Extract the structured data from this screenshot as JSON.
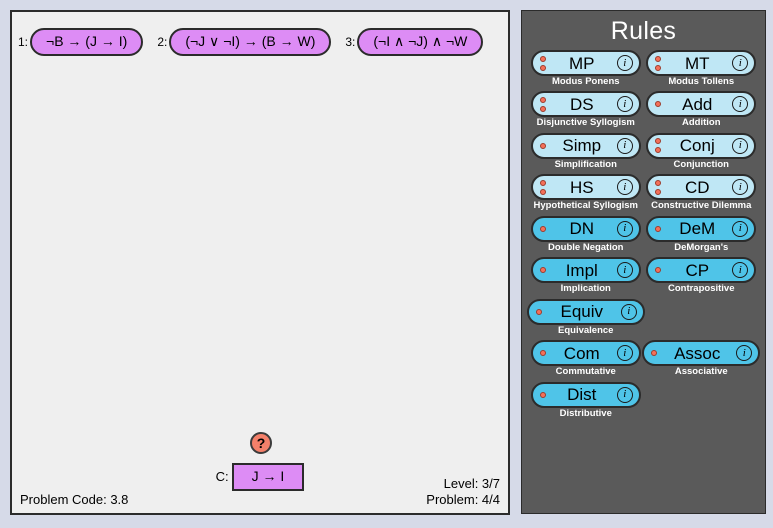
{
  "premises": [
    {
      "index": "1:",
      "formula": "¬B → (J → I)"
    },
    {
      "index": "2:",
      "formula": "(¬J ∨ ¬I) → (B → W)"
    },
    {
      "index": "3:",
      "formula": "(¬I ∧ ¬J) ∧ ¬W"
    }
  ],
  "conclusion": {
    "label": "C:",
    "formula": "J → I",
    "status_badge": "?"
  },
  "footer": {
    "problem_code": "Problem Code: 3.8",
    "level": "Level: 3/7",
    "problem": "Problem: 4/4"
  },
  "rules_panel": {
    "title": "Rules",
    "info_glyph": "i",
    "colors": {
      "panel_bg": "#5a5a5a",
      "button_light": "#bfe7f5",
      "button_dark": "#4fc4e8",
      "dot": "#f4705a",
      "premise_pill": "#dd8cf5",
      "badge": "#f4806a"
    },
    "rules": [
      {
        "abbr": "MP",
        "name": "Modus Ponens",
        "dots": 2,
        "shade": "light",
        "wide": false
      },
      {
        "abbr": "MT",
        "name": "Modus Tollens",
        "dots": 2,
        "shade": "light",
        "wide": false
      },
      {
        "abbr": "DS",
        "name": "Disjunctive Syllogism",
        "dots": 2,
        "shade": "light",
        "wide": false
      },
      {
        "abbr": "Add",
        "name": "Addition",
        "dots": 1,
        "shade": "light",
        "wide": false
      },
      {
        "abbr": "Simp",
        "name": "Simplification",
        "dots": 1,
        "shade": "light",
        "wide": false
      },
      {
        "abbr": "Conj",
        "name": "Conjunction",
        "dots": 2,
        "shade": "light",
        "wide": false
      },
      {
        "abbr": "HS",
        "name": "Hypothetical Syllogism",
        "dots": 2,
        "shade": "light",
        "wide": false
      },
      {
        "abbr": "CD",
        "name": "Constructive Dilemma",
        "dots": 2,
        "shade": "light",
        "wide": false
      },
      {
        "abbr": "DN",
        "name": "Double Negation",
        "dots": 1,
        "shade": "dark",
        "wide": false
      },
      {
        "abbr": "DeM",
        "name": "DeMorgan's",
        "dots": 1,
        "shade": "dark",
        "wide": false
      },
      {
        "abbr": "Impl",
        "name": "Implication",
        "dots": 1,
        "shade": "dark",
        "wide": false
      },
      {
        "abbr": "CP",
        "name": "Contrapositive",
        "dots": 1,
        "shade": "dark",
        "wide": false
      },
      {
        "abbr": "Equiv",
        "name": "Equivalence",
        "dots": 1,
        "shade": "dark",
        "wide": true
      },
      {
        "abbr": "",
        "name": "",
        "dots": 0,
        "shade": "dark",
        "wide": false
      },
      {
        "abbr": "Com",
        "name": "Commutative",
        "dots": 1,
        "shade": "dark",
        "wide": false
      },
      {
        "abbr": "Assoc",
        "name": "Associative",
        "dots": 1,
        "shade": "dark",
        "wide": true
      },
      {
        "abbr": "Dist",
        "name": "Distributive",
        "dots": 1,
        "shade": "dark",
        "wide": false
      },
      {
        "abbr": "",
        "name": "",
        "dots": 0,
        "shade": "dark",
        "wide": false
      }
    ]
  }
}
